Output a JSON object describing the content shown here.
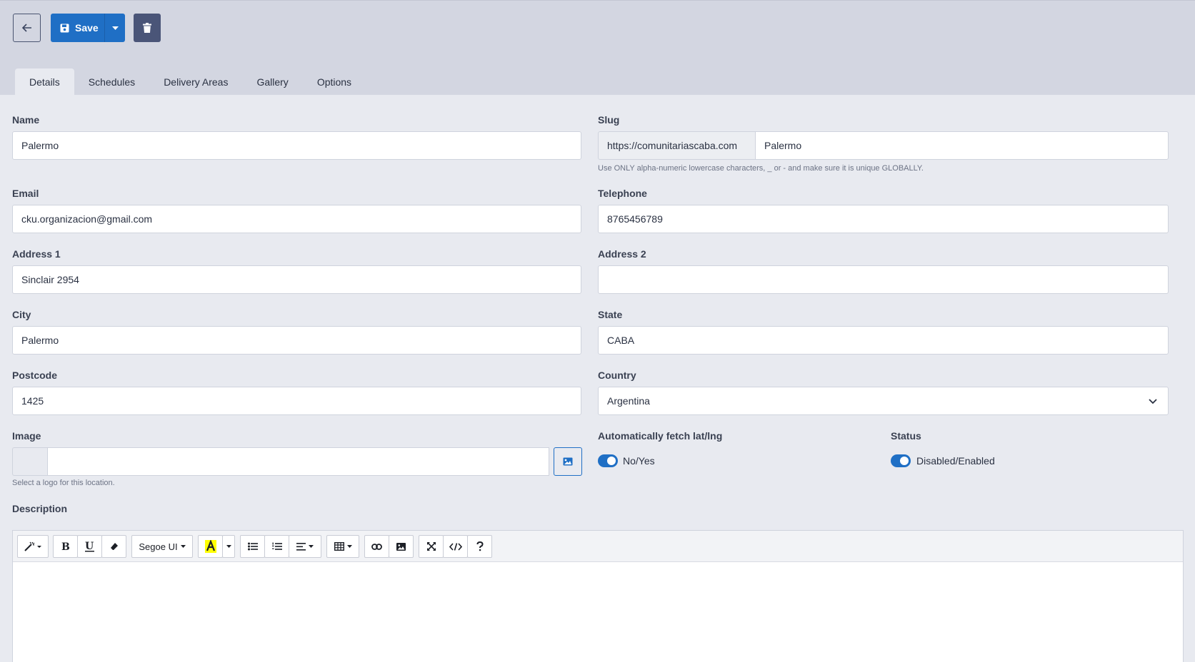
{
  "toolbar": {
    "save_label": "Save"
  },
  "tabs": [
    {
      "label": "Details",
      "active": true
    },
    {
      "label": "Schedules"
    },
    {
      "label": "Delivery Areas"
    },
    {
      "label": "Gallery"
    },
    {
      "label": "Options"
    }
  ],
  "form": {
    "name": {
      "label": "Name",
      "value": "Palermo"
    },
    "slug": {
      "label": "Slug",
      "prefix": "https://comunitariascaba.com",
      "value": "Palermo",
      "hint": "Use ONLY alpha-numeric lowercase characters, _ or - and make sure it is unique GLOBALLY."
    },
    "email": {
      "label": "Email",
      "value": "cku.organizacion@gmail.com"
    },
    "telephone": {
      "label": "Telephone",
      "value": "8765456789"
    },
    "address1": {
      "label": "Address 1",
      "value": "Sinclair 2954"
    },
    "address2": {
      "label": "Address 2",
      "value": ""
    },
    "city": {
      "label": "City",
      "value": "Palermo"
    },
    "state": {
      "label": "State",
      "value": "CABA"
    },
    "postcode": {
      "label": "Postcode",
      "value": "1425"
    },
    "country": {
      "label": "Country",
      "value": "Argentina"
    },
    "image": {
      "label": "Image",
      "value": "",
      "hint": "Select a logo for this location."
    },
    "auto_latlng": {
      "label": "Automatically fetch lat/lng",
      "toggle_text": "No/Yes",
      "on": true
    },
    "status": {
      "label": "Status",
      "toggle_text": "Disabled/Enabled",
      "on": true
    },
    "description": {
      "label": "Description",
      "font_select": "Segoe UI"
    }
  },
  "colors": {
    "accent": "#1f6fc5",
    "header_bg": "#d3d6e1",
    "page_bg": "#e8eaf0"
  }
}
